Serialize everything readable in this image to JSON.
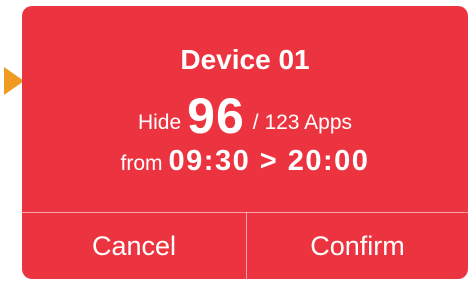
{
  "dialog": {
    "title": "Device 01",
    "hide_prefix": "Hide",
    "hidden_count": "96",
    "total_apps": "/ 123 Apps",
    "from_label": "from",
    "time_range": "09:30 > 20:00",
    "cancel_label": "Cancel",
    "confirm_label": "Confirm"
  },
  "colors": {
    "dialog_background": "#ec3440",
    "pointer": "#f09a21",
    "text": "#ffffff"
  },
  "icons": {
    "pointer": "triangle-pointer-icon"
  }
}
